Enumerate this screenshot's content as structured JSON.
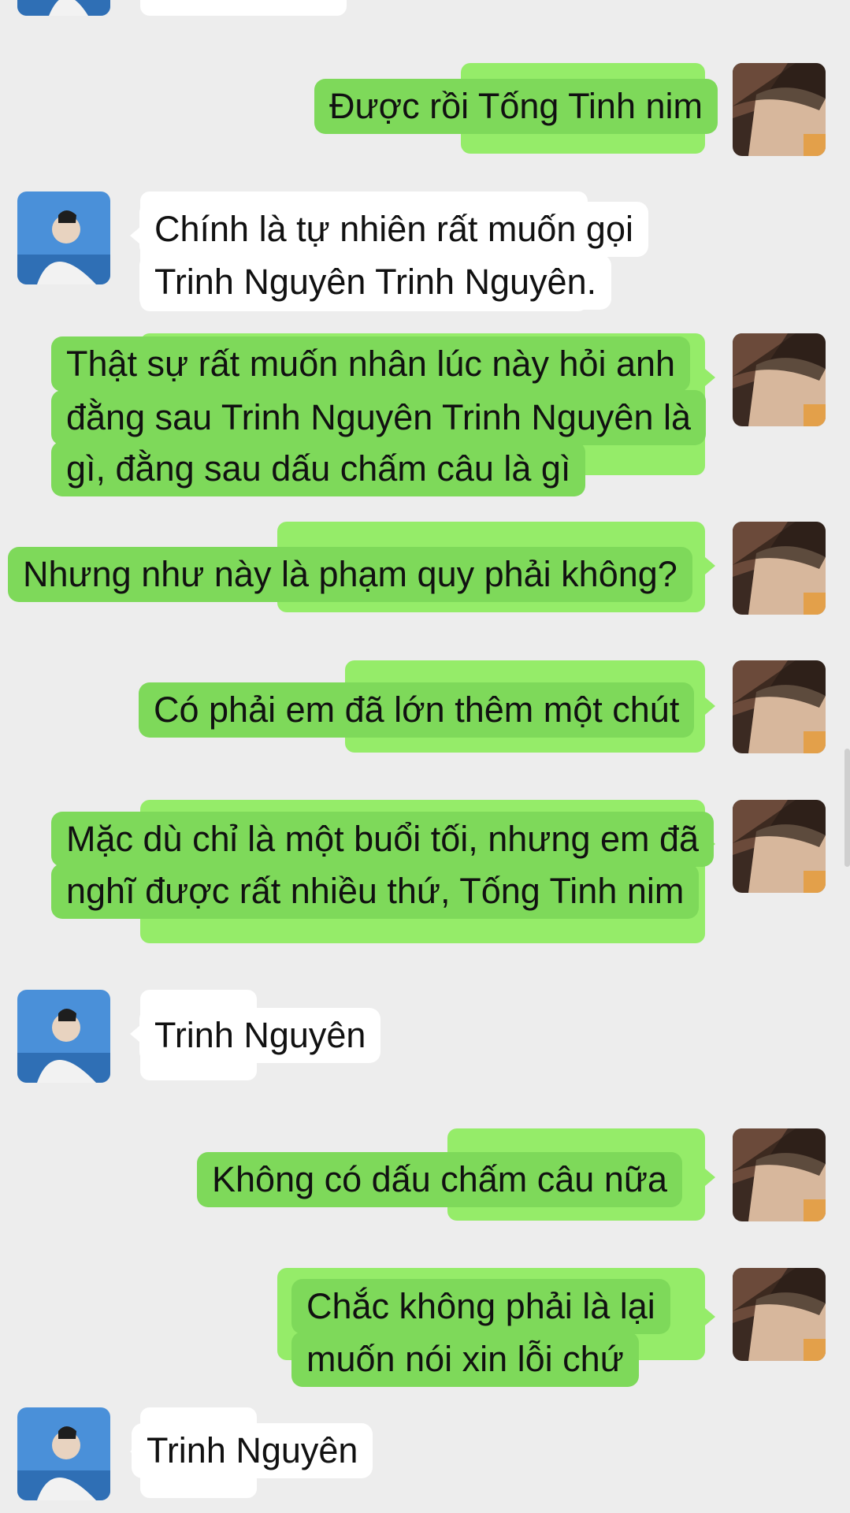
{
  "colors": {
    "background": "#ededed",
    "sent_bubble": "#95ec69",
    "sent_line": "#7ed95a",
    "received_bubble": "#ffffff"
  },
  "messages": [
    {
      "sender": "me",
      "lines": [
        "Được rồi Tống Tinh nim"
      ]
    },
    {
      "sender": "contact",
      "lines": [
        "Chính là tự nhiên rất muốn gọi",
        "Trinh Nguyên Trinh Nguyên."
      ]
    },
    {
      "sender": "me",
      "lines": [
        "Thật sự rất muốn nhân lúc này hỏi anh",
        "đằng sau Trinh Nguyên Trinh Nguyên là",
        "gì, đằng sau dấu chấm câu là gì"
      ]
    },
    {
      "sender": "me",
      "lines": [
        "Nhưng như này là phạm quy phải không?"
      ]
    },
    {
      "sender": "me",
      "lines": [
        "Có phải em đã lớn thêm một chút"
      ]
    },
    {
      "sender": "me",
      "lines": [
        "Mặc dù chỉ là một buổi tối, nhưng em đã",
        "nghĩ được rất nhiều thứ, Tống Tinh nim"
      ]
    },
    {
      "sender": "contact",
      "lines": [
        "Trinh Nguyên"
      ]
    },
    {
      "sender": "me",
      "lines": [
        "Không có dấu chấm câu nữa"
      ]
    },
    {
      "sender": "me",
      "lines": [
        "Chắc không phải là lại",
        "muốn nói xin lỗi chứ"
      ]
    },
    {
      "sender": "contact",
      "lines": [
        "Trinh Nguyên"
      ]
    }
  ],
  "avatars": {
    "me": "my-avatar-icon",
    "contact": "contact-avatar-icon"
  }
}
